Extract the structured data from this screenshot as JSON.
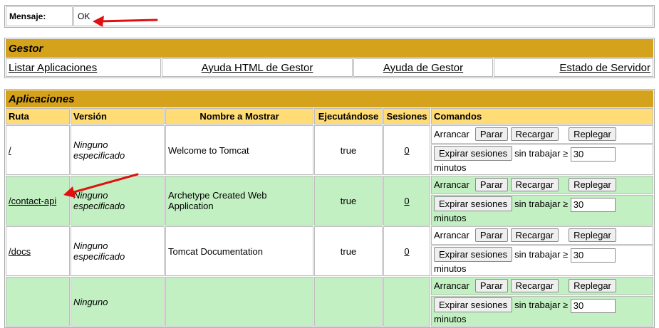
{
  "message": {
    "label": "Mensaje:",
    "value": "OK"
  },
  "manager": {
    "title": "Gestor",
    "links": [
      "Listar Aplicaciones",
      "Ayuda HTML de Gestor",
      "Ayuda de Gestor",
      "Estado de Servidor"
    ]
  },
  "applications": {
    "title": "Aplicaciones",
    "headers": [
      "Ruta",
      "Versión",
      "Nombre a Mostrar",
      "Ejecutándose",
      "Sesiones",
      "Comandos"
    ],
    "rows": [
      {
        "path": "/",
        "version": "Ninguno especificado",
        "display_name": "Welcome to Tomcat",
        "running": "true",
        "sessions": "0"
      },
      {
        "path": "/contact-api",
        "version": "Ninguno especificado",
        "display_name": "Archetype Created Web Application",
        "running": "true",
        "sessions": "0"
      },
      {
        "path": "/docs",
        "version": "Ninguno especificado",
        "display_name": "Tomcat Documentation",
        "running": "true",
        "sessions": "0"
      },
      {
        "path": "",
        "version": "Ninguno",
        "display_name": "",
        "running": "",
        "sessions": ""
      }
    ],
    "commands": {
      "start": "Arrancar",
      "stop": "Parar",
      "reload": "Recargar",
      "undeploy": "Replegar",
      "expire": "Expirar sesiones",
      "idle_text": "sin trabajar ≥",
      "idle_value": "30",
      "minutes": "minutos"
    }
  },
  "colors": {
    "title_bar": "#d5a21c",
    "header_bg": "#ffdc75",
    "row_highlight": "#c3f0c3",
    "arrow": "#e01010"
  }
}
